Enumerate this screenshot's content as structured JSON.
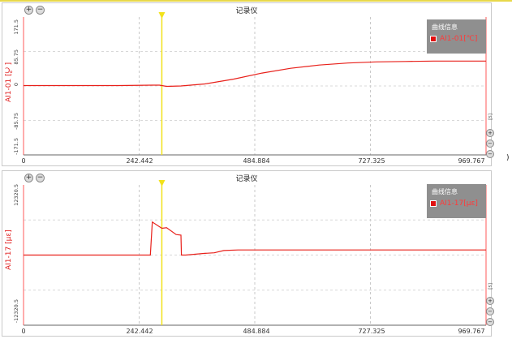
{
  "colors": {
    "trace": "#e8201a",
    "cursor": "#f2e21a",
    "axis": "#ff5a5a",
    "legend_bg": "#8f8f8f"
  },
  "edge_mark": ")",
  "panels": [
    {
      "title": "记录仪",
      "ylabel": "AI1-01 [℃]",
      "yticks": [
        "171.5",
        "85.75",
        "0",
        "-85.75",
        "-171.5"
      ],
      "xticks": [
        "0",
        "242.442",
        "484.884",
        "727.325",
        "969.767"
      ],
      "legend_header": "曲线信息",
      "legend_item": "AI1-01[℃]",
      "right_label": "[s]",
      "toolbar_icons": [
        "zoom-in-icon",
        "zoom-out-icon"
      ]
    },
    {
      "title": "记录仪",
      "ylabel": "AI1-17 [με]",
      "yticks": [
        "12320.5",
        "",
        "",
        "",
        "-12320.5"
      ],
      "xticks": [
        "0",
        "242.442",
        "484.884",
        "727.325",
        "969.767"
      ],
      "legend_header": "曲线信息",
      "legend_item": "AI1-17[με]",
      "right_label": "[s]",
      "toolbar_icons": [
        "zoom-in-icon",
        "zoom-out-icon"
      ]
    }
  ],
  "chart_data": [
    {
      "type": "line",
      "title": "记录仪",
      "ylabel": "AI1-01 [℃]",
      "xlim": [
        0,
        969.767
      ],
      "ylim": [
        -171.5,
        171.5
      ],
      "cursor_x": 290,
      "series": [
        {
          "name": "AI1-01[℃]",
          "x": [
            0,
            100,
            200,
            270,
            285,
            300,
            330,
            380,
            440,
            500,
            560,
            620,
            680,
            740,
            800,
            860,
            920,
            969.767
          ],
          "y": [
            1,
            1,
            1,
            2,
            2,
            -1,
            0,
            5,
            17,
            32,
            44,
            52,
            57,
            60,
            61,
            62,
            62,
            62
          ]
        }
      ]
    },
    {
      "type": "line",
      "title": "记录仪",
      "ylabel": "AI1-17 [με]",
      "xlim": [
        0,
        969.767
      ],
      "ylim": [
        -12320.5,
        12320.5
      ],
      "cursor_x": 290,
      "series": [
        {
          "name": "AI1-17[με]",
          "x": [
            0,
            230,
            265,
            266,
            270,
            290,
            300,
            320,
            330,
            331,
            340,
            380,
            400,
            420,
            450,
            500,
            600,
            969.767
          ],
          "y": [
            0,
            0,
            0,
            0,
            5800,
            4700,
            4800,
            3600,
            3500,
            0,
            0,
            300,
            400,
            800,
            900,
            900,
            900,
            900
          ]
        }
      ]
    }
  ]
}
